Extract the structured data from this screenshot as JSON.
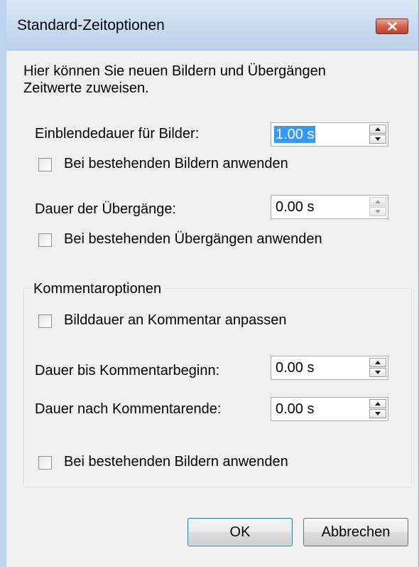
{
  "window": {
    "title": "Standard-Zeitoptionen"
  },
  "intro_text": "Hier können Sie neuen Bildern und Übergängen Zeitwerte zuweisen.",
  "image_duration": {
    "label": "Einblendedauer für Bilder:",
    "value": "1.00 s",
    "apply_existing_label": "Bei bestehenden Bildern anwenden",
    "apply_existing_checked": false
  },
  "transition_duration": {
    "label": "Dauer der Übergänge:",
    "value": "0.00 s",
    "apply_existing_label": "Bei bestehenden Übergängen anwenden",
    "apply_existing_checked": false
  },
  "comment_options": {
    "group_title": "Kommentaroptionen",
    "fit_label": "Bilddauer an Kommentar anpassen",
    "fit_checked": false,
    "before_label": "Dauer bis Kommentarbeginn:",
    "before_value": "0.00 s",
    "after_label": "Dauer nach Kommentarende:",
    "after_value": "0.00 s"
  },
  "apply_existing_images_label": "Bei bestehenden Bildern anwenden",
  "apply_existing_images_checked": false,
  "buttons": {
    "ok": "OK",
    "cancel": "Abbrechen"
  },
  "icons": {
    "close": "close-icon",
    "spin_up": "spin-up-arrow-icon",
    "spin_down": "spin-down-arrow-icon"
  },
  "colors": {
    "close_button": "#c0402a",
    "selection": "#3399ff"
  }
}
